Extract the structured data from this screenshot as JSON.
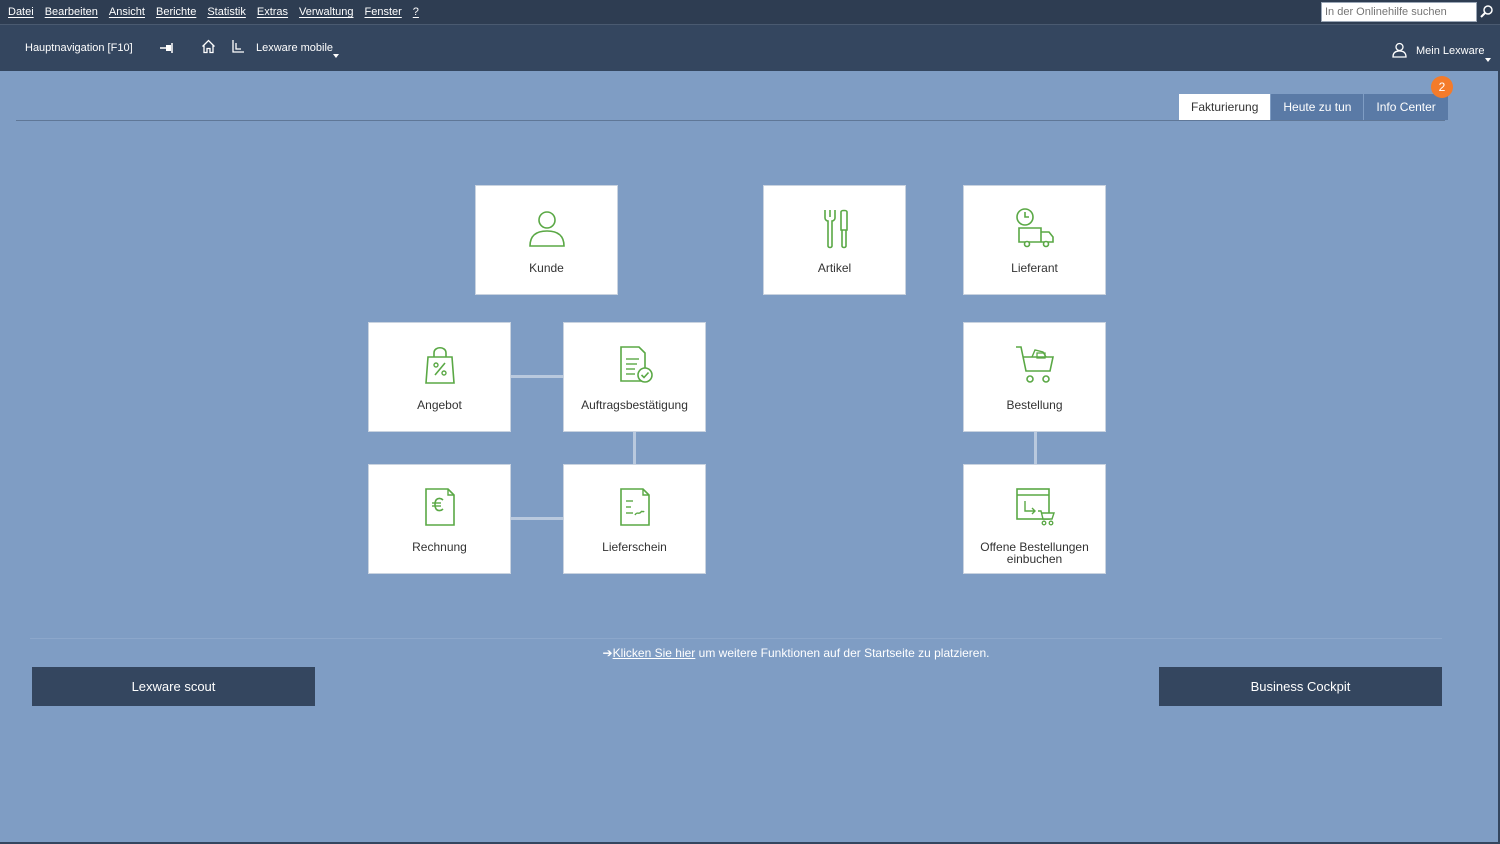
{
  "menubar": {
    "items": [
      "Datei",
      "Bearbeiten",
      "Ansicht",
      "Berichte",
      "Statistik",
      "Extras",
      "Verwaltung",
      "Fenster",
      "?"
    ],
    "search_placeholder": "In der Onlinehilfe suchen"
  },
  "toolbar": {
    "nav_label": "Hauptnavigation [F10]",
    "mobile_label": "Lexware mobile",
    "user_label": "Mein Lexware"
  },
  "tabs": [
    {
      "label": "Fakturierung",
      "active": true
    },
    {
      "label": "Heute zu tun",
      "active": false
    },
    {
      "label": "Info Center",
      "active": false
    }
  ],
  "info_center_badge": "2",
  "tiles": {
    "kunde": "Kunde",
    "artikel": "Artikel",
    "lieferant": "Lieferant",
    "angebot": "Angebot",
    "auftrag": "Auftragsbestätigung",
    "bestellung": "Bestellung",
    "rechnung": "Rechnung",
    "lieferschein": "Lieferschein",
    "offene_line1": "Offene Bestellungen",
    "offene_line2": "einbuchen"
  },
  "hint": {
    "link": "Klicken Sie hier",
    "text": " um weitere Funktionen auf der Startseite zu platzieren."
  },
  "buttons": {
    "scout": "Lexware scout",
    "cockpit": "Business Cockpit"
  },
  "colors": {
    "background": "#7f9dc4",
    "bar": "#34465f",
    "icon_green": "#5aa845",
    "badge": "#f47b2a"
  }
}
